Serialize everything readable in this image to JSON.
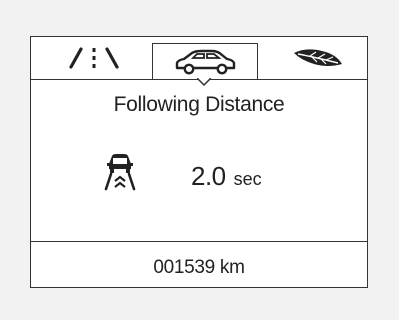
{
  "screen": {
    "title": "Following Distance",
    "gap": {
      "value": "2.0",
      "unit": "sec"
    },
    "odometer": "001539 km"
  },
  "tabs": [
    {
      "icon": "lane-icon",
      "selected": false
    },
    {
      "icon": "car-icon",
      "selected": true
    },
    {
      "icon": "eco-leaf-icon",
      "selected": false
    }
  ],
  "colors": {
    "line": "#333333",
    "text": "#222222",
    "background": "#ffffff"
  }
}
